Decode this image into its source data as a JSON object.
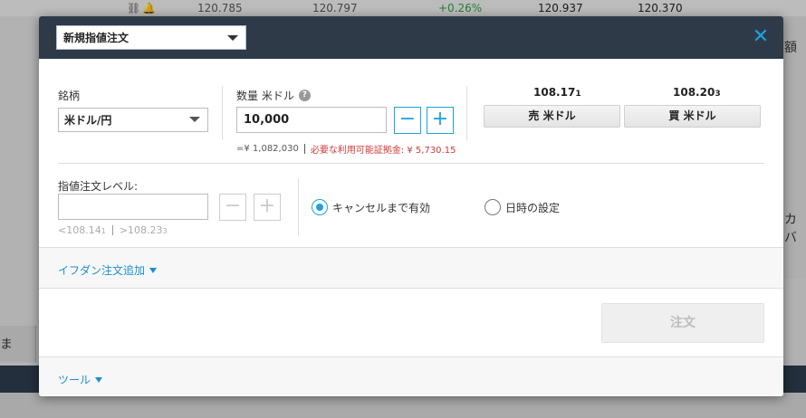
{
  "background": {
    "cells": [
      "120.785",
      "120.797",
      "+0.26%",
      "120.937",
      "120.370"
    ],
    "side_text_1": "額",
    "side_text_2": "カバ",
    "left_tab": "ま"
  },
  "modal": {
    "order_type": "新規指値注文",
    "close_symbol": "✕",
    "symbol_label": "銘柄",
    "symbol_value": "米ドル/円",
    "quantity_label": "数量 米ドル",
    "help_symbol": "?",
    "quantity_value": "10,000",
    "minus": "−",
    "plus": "+",
    "notional": "=¥ 1,082,030",
    "margin_note": "必要な利用可能証拠金: ¥ 5,730.15",
    "sell_price_main": "108.17",
    "sell_price_small": "1",
    "buy_price_main": "108.20",
    "buy_price_small": "3",
    "sell_button": "売 米ドル",
    "buy_button": "買 米ドル",
    "limit_label": "指値注文レベル:",
    "limit_value": "",
    "limit_lower_main": "<108.14",
    "limit_lower_small": "1",
    "limit_upper_main": ">108.23",
    "limit_upper_small": "3",
    "radio_gtc": "キャンセルまで有効",
    "radio_gtd": "日時の設定",
    "ifdone_link": "イフダン注文追加",
    "order_button": "注文",
    "tools_link": "ツール"
  },
  "colors": {
    "header": "#2e3a48",
    "accent": "#1da3e0",
    "up": "#2a9d3f",
    "warning": "#d0393a"
  }
}
